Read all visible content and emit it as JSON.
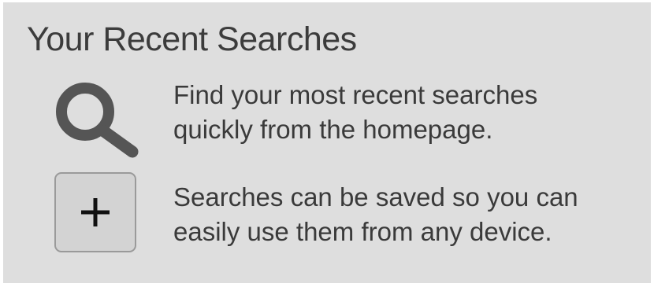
{
  "panel": {
    "title": "Your Recent Searches",
    "background": "#dedede",
    "text_color": "#3a3a3a"
  },
  "features": [
    {
      "icon": "search-icon",
      "line1": "Find your most recent searches",
      "line2": "quickly from the homepage."
    },
    {
      "icon": "plus-icon",
      "line1": "Searches can be saved so you can",
      "line2": "easily use them from any device."
    }
  ]
}
